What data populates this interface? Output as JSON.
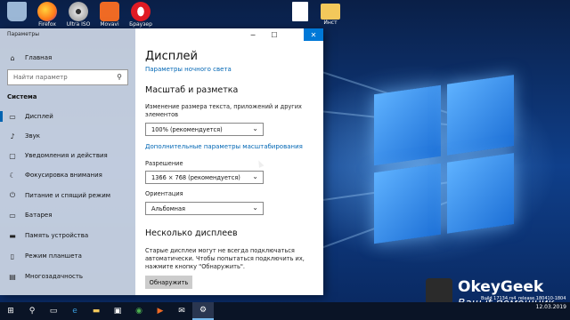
{
  "desktop": {
    "icons": [
      {
        "label": "",
        "icon": "recycle-bin-icon",
        "color": "#9bb7d6"
      },
      {
        "label": "Firefox",
        "icon": "firefox-icon",
        "color": "#ff7a1a"
      },
      {
        "label": "Ultra ISO",
        "icon": "disc-icon",
        "color": "#c9c9c9"
      },
      {
        "label": "Movavi",
        "icon": "movavi-icon",
        "color": "#ef6a24"
      },
      {
        "label": "Браузер",
        "icon": "opera-icon",
        "color": "#e01b24"
      },
      {
        "label": "",
        "icon": "document-icon",
        "color": "#ffffff"
      },
      {
        "label": "Инст",
        "icon": "folder-icon",
        "color": "#f3c85b"
      }
    ]
  },
  "settings": {
    "window_title": "Параметры",
    "nav": {
      "home": "Главная",
      "search_placeholder": "Найти параметр",
      "section": "Система",
      "items": [
        {
          "label": "Дисплей",
          "icon": "display-icon",
          "glyph": "▭"
        },
        {
          "label": "Звук",
          "icon": "sound-icon",
          "glyph": "♪"
        },
        {
          "label": "Уведомления и действия",
          "icon": "notifications-icon",
          "glyph": "▢"
        },
        {
          "label": "Фокусировка внимания",
          "icon": "focus-icon",
          "glyph": "☾"
        },
        {
          "label": "Питание и спящий режим",
          "icon": "power-icon",
          "glyph": "⏻"
        },
        {
          "label": "Батарея",
          "icon": "battery-icon",
          "glyph": "▭"
        },
        {
          "label": "Память устройства",
          "icon": "storage-icon",
          "glyph": "▬"
        },
        {
          "label": "Режим планшета",
          "icon": "tablet-icon",
          "glyph": "▯"
        },
        {
          "label": "Многозадачность",
          "icon": "multitasking-icon",
          "glyph": "▤"
        }
      ]
    },
    "content": {
      "title": "Дисплей",
      "night_light_link": "Параметры ночного света",
      "scale_header": "Масштаб и разметка",
      "scale_label": "Изменение размера текста, приложений и других элементов",
      "scale_value": "100% (рекомендуется)",
      "advanced_scale_link": "Дополнительные параметры масштабирования",
      "resolution_label": "Разрешение",
      "resolution_value": "1366 × 768 (рекомендуется)",
      "orientation_label": "Ориентация",
      "orientation_value": "Альбомная",
      "multi_header": "Несколько дисплеев",
      "multi_text": "Старые дисплеи могут не всегда подключаться автоматически. Чтобы попытаться подключить их, нажмите кнопку \"Обнаружить\".",
      "detect_button": "Обнаружить"
    }
  },
  "watermark": {
    "title": "OkeyGeek",
    "subtitle": "Ваш it-помощник"
  },
  "build_text": "Build 17134.rs4_release.180410-1804",
  "clock": {
    "date": "12.03.2019"
  },
  "colors": {
    "accent": "#0078d7",
    "link": "#0066b4",
    "close": "#0078d7"
  }
}
